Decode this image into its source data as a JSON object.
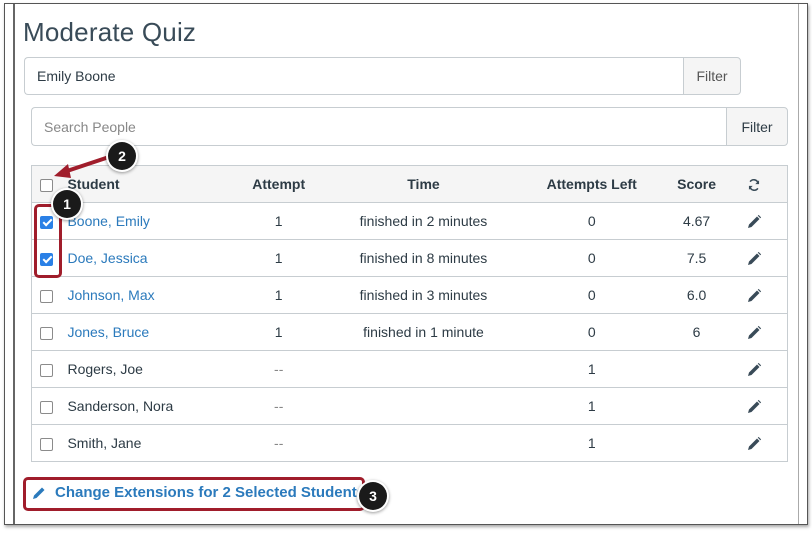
{
  "page": {
    "title": "Moderate Quiz"
  },
  "student_filter": {
    "value": "Emily Boone",
    "button": "Filter"
  },
  "people_search": {
    "placeholder": "Search People",
    "button": "Filter"
  },
  "table": {
    "headers": {
      "student": "Student",
      "attempt": "Attempt",
      "time": "Time",
      "attempts_left": "Attempts Left",
      "score": "Score"
    },
    "select_all_checked": false,
    "rows": [
      {
        "name": "Boone, Emily",
        "linked": true,
        "checked": true,
        "attempt": "1",
        "time": "finished in 2 minutes",
        "attempts_left": "0",
        "score": "4.67"
      },
      {
        "name": "Doe, Jessica",
        "linked": true,
        "checked": true,
        "attempt": "1",
        "time": "finished in 8 minutes",
        "attempts_left": "0",
        "score": "7.5"
      },
      {
        "name": "Johnson, Max",
        "linked": true,
        "checked": false,
        "attempt": "1",
        "time": "finished in 3 minutes",
        "attempts_left": "0",
        "score": "6.0"
      },
      {
        "name": "Jones, Bruce",
        "linked": true,
        "checked": false,
        "attempt": "1",
        "time": "finished in 1 minute",
        "attempts_left": "0",
        "score": "6"
      },
      {
        "name": "Rogers, Joe",
        "linked": false,
        "checked": false,
        "attempt": "--",
        "time": "",
        "attempts_left": "1",
        "score": ""
      },
      {
        "name": "Sanderson, Nora",
        "linked": false,
        "checked": false,
        "attempt": "--",
        "time": "",
        "attempts_left": "1",
        "score": ""
      },
      {
        "name": "Smith, Jane",
        "linked": false,
        "checked": false,
        "attempt": "--",
        "time": "",
        "attempts_left": "1",
        "score": ""
      }
    ]
  },
  "extensions_link": {
    "label": "Change Extensions for 2 Selected Students"
  },
  "callouts": {
    "one": "1",
    "two": "2",
    "three": "3"
  },
  "colors": {
    "link": "#2b7abc",
    "checkbox": "#2a80e6",
    "highlight": "#a01d2b",
    "header_bg": "#f5f5f5"
  },
  "icons": {
    "row_action": "pencil-icon",
    "header_action": "refresh-icon",
    "link_icon": "pencil-icon"
  }
}
